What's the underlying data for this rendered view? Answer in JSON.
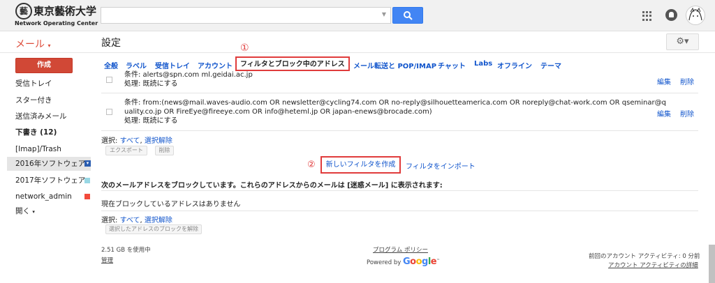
{
  "header": {
    "logo_mark": "藝",
    "logo_jp": "東京藝術大学",
    "logo_en": "Network Operating Center",
    "search_placeholder": ""
  },
  "toolbar": {
    "mail_label": "メール",
    "page_title": "設定",
    "gear_label": "⚙▾"
  },
  "sidebar": {
    "compose": "作成",
    "items": [
      {
        "label": "受信トレイ"
      },
      {
        "label": "スター付き"
      },
      {
        "label": "送信済みメール"
      },
      {
        "label": "下書き (12)"
      },
      {
        "label": "[Imap]/Trash"
      },
      {
        "label": "2016年ソフトウェア",
        "color": "#2a5db0"
      },
      {
        "label": "2017年ソフトウェア",
        "color": "#98d7e4"
      },
      {
        "label": "network_admin",
        "color": "#f24a3b"
      },
      {
        "label": "開く"
      }
    ]
  },
  "tabs": [
    "全般",
    "ラベル",
    "受信トレイ",
    "アカウント",
    "フィルタとブロック中のアドレス",
    "メール転送と POP/IMAP",
    "チャット",
    "Labs",
    "オフライン",
    "テーマ"
  ],
  "annotations": {
    "one": "①",
    "two": "②"
  },
  "filters": [
    {
      "line1": "条件: alerts@spn.com ml.geidai.ac.jp",
      "line2": "処理: 既読にする"
    },
    {
      "line1": "条件: from:(news@mail.waves-audio.com OR newsletter@cycling74.com OR no-reply@silhouetteamerica.com OR noreply@chat-work.com OR qseminar@q",
      "line2": "uality.co.jp OR FireEye@fireeye.com OR info@heteml.jp OR japan-enews@brocade.com)",
      "line3": "処理: 既読にする"
    }
  ],
  "row_actions": {
    "edit": "編集",
    "delete": "削除"
  },
  "selection": {
    "prefix": "選択:",
    "all": "すべて",
    "sep": ",",
    "none": "選択解除"
  },
  "buttons": {
    "export": "エクスポート",
    "delete": "削除",
    "create_filter": "新しいフィルタを作成",
    "import_filter": "フィルタをインポート",
    "unblock": "選択したアドレスのブロックを解除"
  },
  "blocked": {
    "heading": "次のメールアドレスをブロックしています。これらのアドレスからのメールは [迷惑メール] に表示されます:",
    "empty": "現在ブロックしているアドレスはありません"
  },
  "footer": {
    "storage": "2.51 GB を使用中",
    "manage": "管理",
    "policy": "プログラム ポリシー",
    "powered_by": "Powered by",
    "google": "Google",
    "activity": "前回のアカウント アクティビティ: 0 分前",
    "activity_link": "アカウント アクティビティの詳細"
  }
}
